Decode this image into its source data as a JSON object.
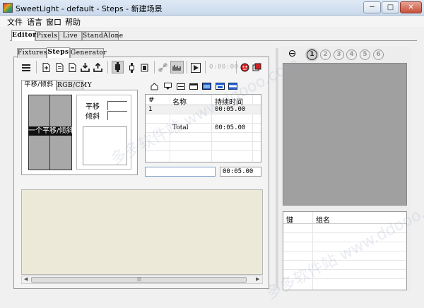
{
  "window": {
    "title": "SweetLight - default - Steps - 新建场景",
    "minimize": "─",
    "maximize": "□",
    "close": "✕"
  },
  "menu": [
    "文件",
    "语言",
    "窗口",
    "帮助"
  ],
  "main_tabs": [
    "Editor",
    "Pixels",
    "Live",
    "StandAlone"
  ],
  "sub_tabs": [
    "Fixtures",
    "Steps",
    "Generator"
  ],
  "toolbar": {
    "time_display": "0:00:00"
  },
  "pantilt": {
    "tabs": [
      "平移/倾斜",
      "RGB/CMY"
    ],
    "preview_label": "一个平移/倾斜",
    "pan_label": "平移",
    "tilt_label": "倾斜"
  },
  "steps_table": {
    "headers": [
      "#",
      "名称",
      "持续时间"
    ],
    "rows": [
      {
        "num": "1",
        "name": "",
        "duration": "00:05.00"
      },
      {
        "num": "",
        "name": "",
        "duration": ""
      },
      {
        "num": "",
        "name": "Total",
        "duration": "00:05.00"
      }
    ],
    "name_input": "",
    "duration_input": "00:05.00"
  },
  "right_panel": {
    "minus_button": "⊖",
    "numbers": [
      "1",
      "2",
      "3",
      "4",
      "5",
      "6"
    ],
    "group_headers": [
      "键",
      "组名"
    ]
  },
  "watermark": "多多软件站 www.ddooo.com",
  "colors": {
    "accent_red": "#d42020",
    "accent_blue": "#2060d0",
    "preview_bg": "#a8a8a8",
    "workspace_bg": "#ece9d8",
    "right_preview_bg": "#a0a0a0"
  }
}
